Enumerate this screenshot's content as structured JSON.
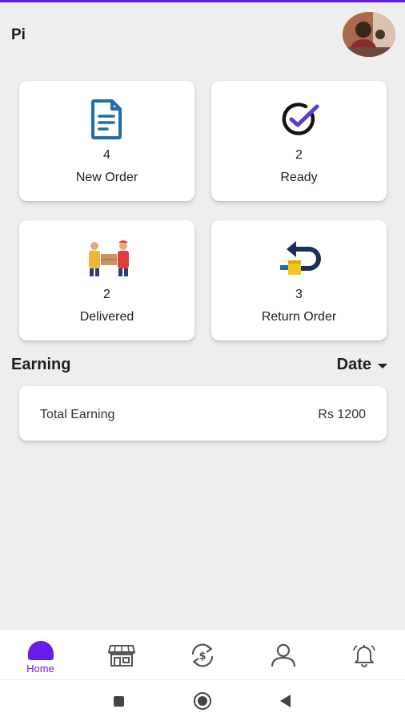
{
  "header": {
    "user_name": "Pi"
  },
  "cards": [
    {
      "count": "4",
      "label": "New Order",
      "icon": "document-icon"
    },
    {
      "count": "2",
      "label": "Ready",
      "icon": "check-circle-icon"
    },
    {
      "count": "2",
      "label": "Delivered",
      "icon": "delivery-icon"
    },
    {
      "count": "3",
      "label": "Return Order",
      "icon": "return-box-icon"
    }
  ],
  "earning": {
    "title": "Earning",
    "filter_label": "Date",
    "total_label": "Total Earning",
    "total_value": "Rs 1200"
  },
  "nav": {
    "items": [
      {
        "label": "Home",
        "icon": "home-icon",
        "active": true
      },
      {
        "label": "",
        "icon": "store-icon",
        "active": false
      },
      {
        "label": "",
        "icon": "exchange-icon",
        "active": false
      },
      {
        "label": "",
        "icon": "profile-icon",
        "active": false
      },
      {
        "label": "",
        "icon": "bell-icon",
        "active": false
      }
    ]
  },
  "colors": {
    "accent": "#6a1de6",
    "background": "#eeeeee",
    "card": "#ffffff",
    "icon_blue": "#1e6fa8",
    "icon_navy": "#1c2f5c"
  }
}
